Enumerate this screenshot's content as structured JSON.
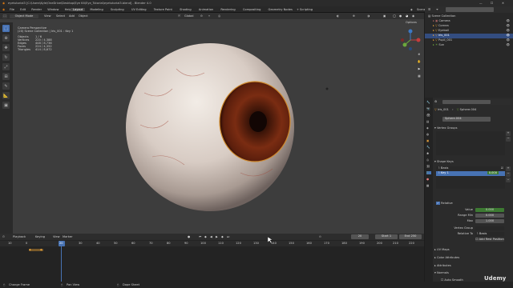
{
  "title": {
    "path": "eyetutorial3 [C:\\Users\\Kyle\\OneDrive\\Desktop\\Eye Kit\\Eye_Tutorial\\eyetutorial3.blend] - Blender 4.0"
  },
  "menubar": {
    "menus": [
      "File",
      "Edit",
      "Render",
      "Window",
      "Help"
    ],
    "workspaces": [
      "Layout",
      "Modeling",
      "Sculpting",
      "UV Editing",
      "Texture Paint",
      "Shading",
      "Animation",
      "Rendering",
      "Compositing",
      "Geometry Nodes",
      "Scripting"
    ],
    "active_workspace": "Layout",
    "scene": "Scene",
    "view_layer": "ViewLayer"
  },
  "viewport_header": {
    "mode": "Object Mode",
    "menus": [
      "View",
      "Select",
      "Add",
      "Object"
    ],
    "transform": "Global",
    "options": "Options"
  },
  "viewport_overlay": {
    "line1": "Camera Perspective",
    "line2": "(20) Scene Collection | Iris_001 : Key 1",
    "stats": [
      {
        "label": "Objects",
        "value": "1 / 6"
      },
      {
        "label": "Vertices",
        "value": "220 / 4,388"
      },
      {
        "label": "Edges",
        "value": "448 / 8,736"
      },
      {
        "label": "Faces",
        "value": "224 / 4,352"
      },
      {
        "label": "Triangles",
        "value": "414 / 8,672"
      }
    ]
  },
  "outliner": {
    "header": "Scene Collection",
    "items": [
      {
        "name": "Camera",
        "selected": false
      },
      {
        "name": "Cornea",
        "selected": false
      },
      {
        "name": "Eyeball",
        "selected": false
      },
      {
        "name": "Iris_001",
        "selected": true
      },
      {
        "name": "Pupil_001",
        "selected": false
      },
      {
        "name": "Sun",
        "selected": false
      }
    ]
  },
  "properties": {
    "object_name": "Iris_001",
    "data_name": "Sphere.004",
    "mesh_field": "Sphere.004",
    "vertex_groups_label": "Vertex Groups",
    "shape_keys_label": "Shape Keys",
    "shape_keys": [
      {
        "name": "Basis",
        "value": ""
      },
      {
        "name": "Key 1",
        "value": "0.000"
      }
    ],
    "relative_label": "Relative",
    "value_label": "Value",
    "value": "0.000",
    "range_min_label": "Range Min",
    "range_min": "0.000",
    "max_label": "Max",
    "max": "1.000",
    "vertex_group_label": "Vertex Group",
    "relative_to_label": "Relative To",
    "relative_to": "Basis",
    "add_rest_label": "Add Rest Position",
    "sections": [
      "UV Maps",
      "Color Attributes",
      "Attributes",
      "Normals",
      "Texture Space",
      "Remesh"
    ],
    "auto_smooth": "Auto Smooth"
  },
  "timeline": {
    "menus": [
      "Playback",
      "Keying",
      "View",
      "Marker"
    ],
    "current_frame": "20",
    "start_label": "Start",
    "start": "1",
    "end_label": "End",
    "end": "250",
    "ticks": [
      "10",
      "0",
      "20",
      "30",
      "40",
      "50",
      "60",
      "70",
      "80",
      "90",
      "100",
      "110",
      "120",
      "130",
      "140",
      "150",
      "160",
      "170",
      "180",
      "190",
      "200",
      "210",
      "220",
      "230",
      "240",
      "250"
    ],
    "playhead_label": "20"
  },
  "statusbar": {
    "items": [
      "Change Frame",
      "Pan View",
      "Dope Sheet"
    ],
    "watermark": "Udemy"
  },
  "colors": {
    "accent": "#4772b3",
    "timeline_playhead": "#4772b3",
    "keyframe": "#e6a23c",
    "relative_check": "#4772b3",
    "value_field": "#3d7a32"
  }
}
